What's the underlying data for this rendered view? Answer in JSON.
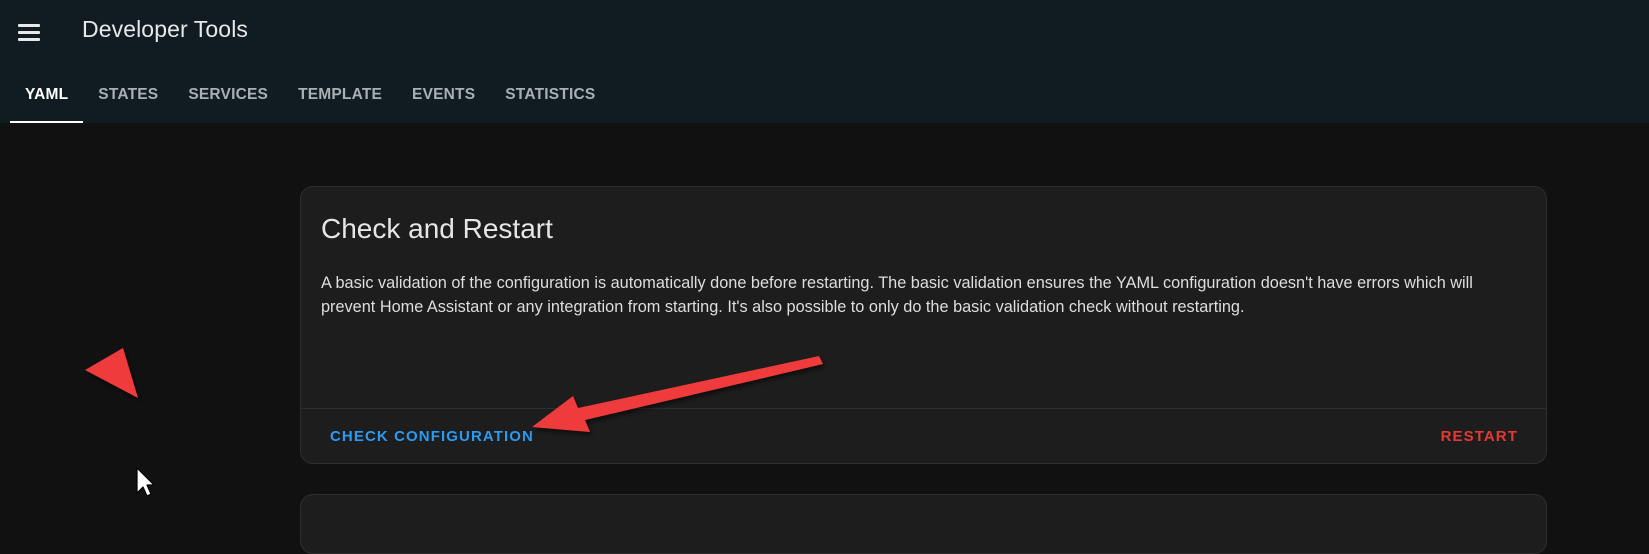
{
  "header": {
    "menu_icon": "hamburger-menu-icon",
    "title": "Developer Tools"
  },
  "tabs": [
    {
      "label": "YAML",
      "active": true
    },
    {
      "label": "STATES",
      "active": false
    },
    {
      "label": "SERVICES",
      "active": false
    },
    {
      "label": "TEMPLATE",
      "active": false
    },
    {
      "label": "EVENTS",
      "active": false
    },
    {
      "label": "STATISTICS",
      "active": false
    }
  ],
  "check_restart_card": {
    "title": "Check and Restart",
    "description": "A basic validation of the configuration is automatically done before restarting. The basic validation ensures the YAML configuration doesn't have errors which will prevent Home Assistant or any integration from starting. It's also possible to only do the basic validation check without restarting.",
    "check_button": "CHECK CONFIGURATION",
    "restart_button": "RESTART"
  },
  "colors": {
    "topbar": "#111c22",
    "background": "#111111",
    "card": "#1d1d1d",
    "primary": "#2b9af3",
    "error": "#e53935",
    "annotation_arrow": "#ef3b3b"
  },
  "annotations": {
    "arrow": "red-arrow-pointing-to-check-configuration",
    "triangle": "red-triangle-marker",
    "cursor": "mouse-pointer-icon"
  }
}
